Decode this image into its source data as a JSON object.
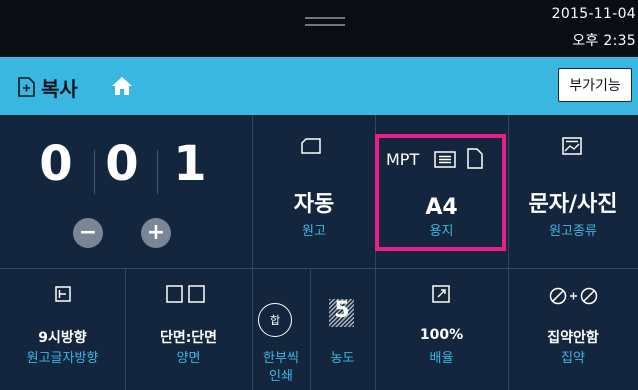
{
  "status": {
    "date": "2015-11-04",
    "time": "오후 2:35"
  },
  "header": {
    "title": "복사",
    "extra_button": "부가기능"
  },
  "counter": {
    "digits": [
      "0",
      "0",
      "1"
    ],
    "minus": "−",
    "plus": "+"
  },
  "top_row": {
    "original": {
      "value": "자동",
      "label": "원고"
    },
    "paper": {
      "tray": "MPT",
      "value": "A4",
      "label": "용지"
    },
    "type": {
      "value": "문자/사진",
      "label": "원고종류"
    }
  },
  "bottom_row": {
    "orientation": {
      "value": "9시방향",
      "label": "원고글자방향"
    },
    "duplex": {
      "value": "단면:단면",
      "label": "양면"
    },
    "collate": {
      "circle": "합",
      "label_line1": "한부씩",
      "label_line2": "인쇄"
    },
    "density": {
      "value": "5",
      "label": "농도"
    },
    "zoom": {
      "value": "100%",
      "label": "배율"
    },
    "nup": {
      "value": "집약안함",
      "label": "집약"
    }
  },
  "colors": {
    "accent": "#3ab7e0",
    "highlight": "#e91e8c",
    "panel": "#14263d"
  }
}
